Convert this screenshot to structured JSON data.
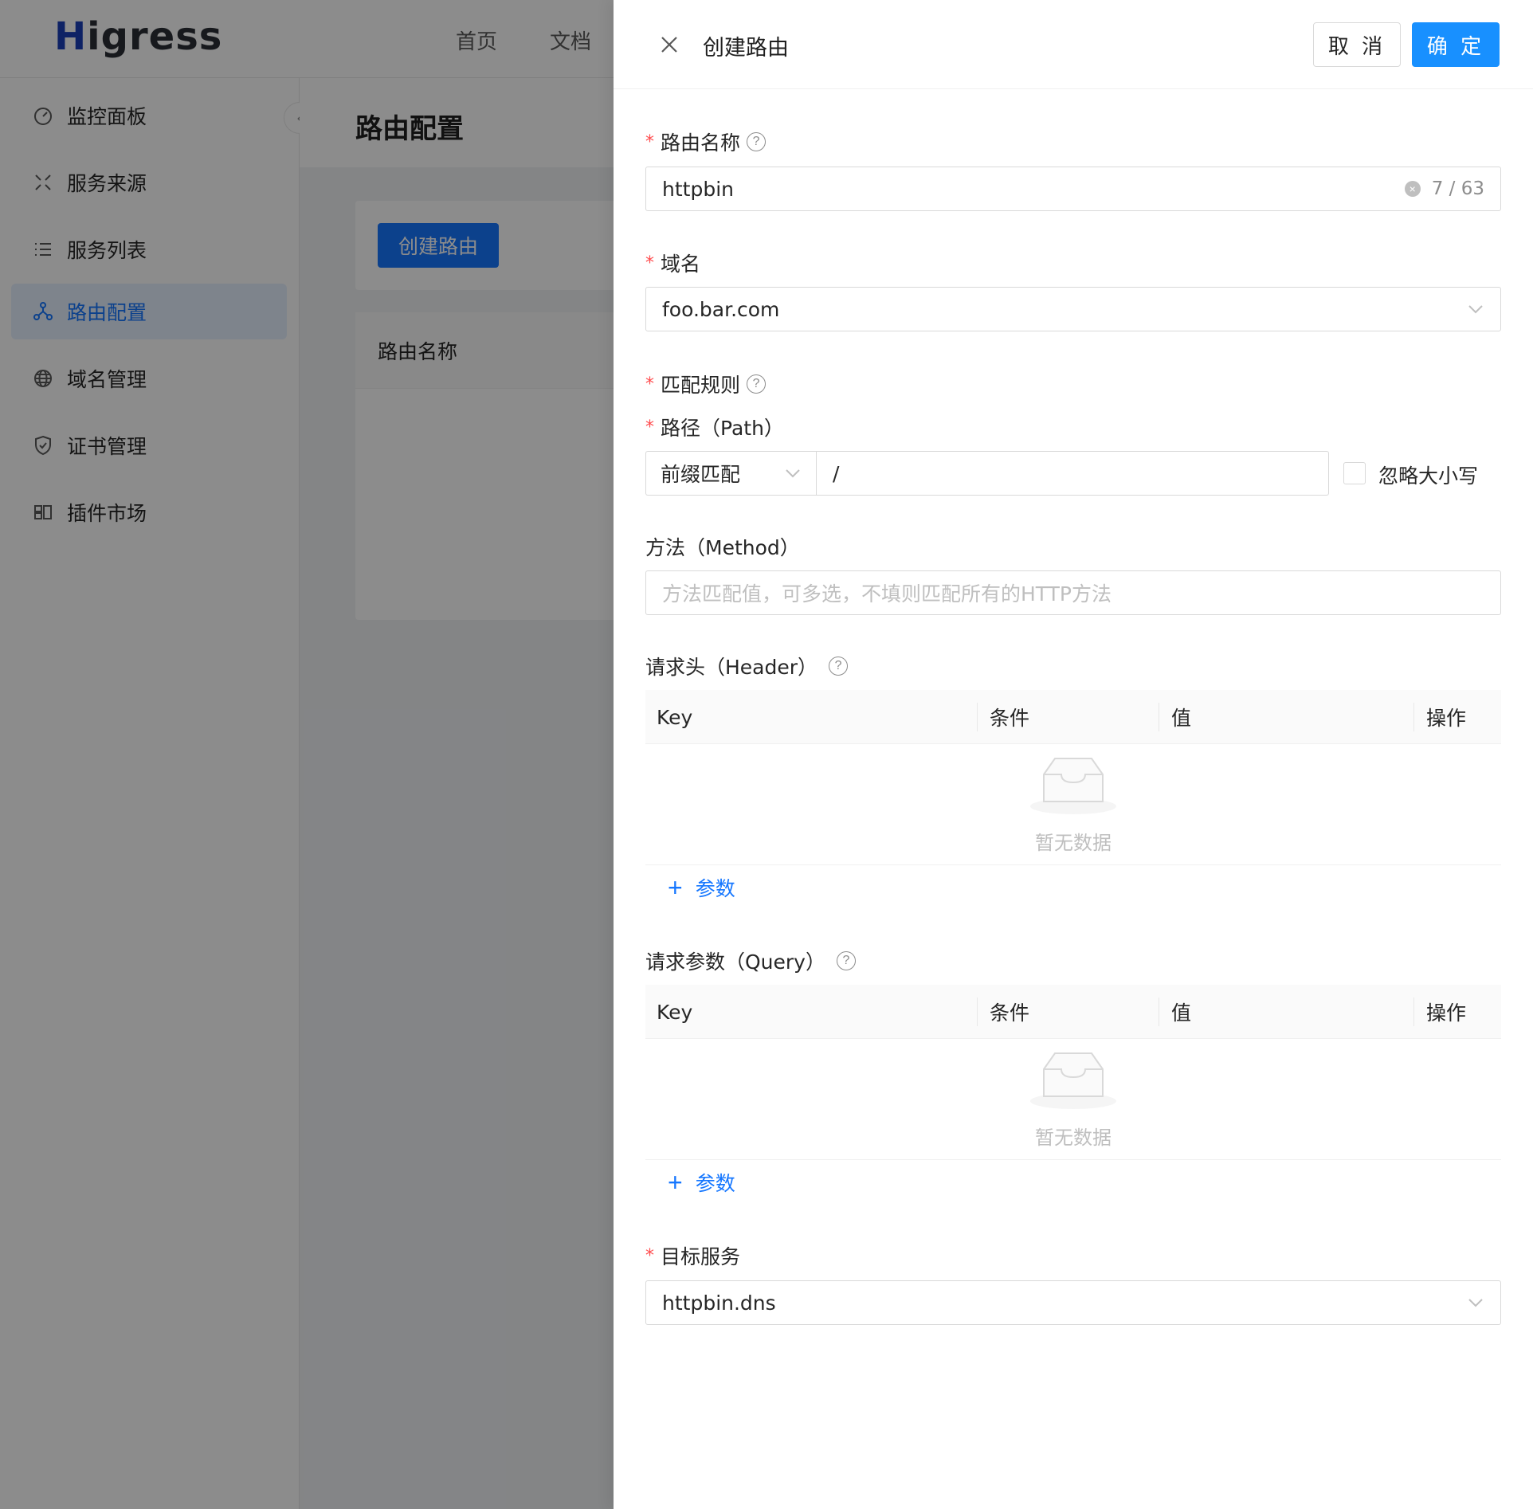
{
  "app": {
    "logo_prefix": "H",
    "logo_rest": "igress",
    "topnav": [
      "首页",
      "文档"
    ]
  },
  "sidebar": {
    "items": [
      {
        "label": "监控面板",
        "icon": "dashboard-icon"
      },
      {
        "label": "服务来源",
        "icon": "service-source-icon"
      },
      {
        "label": "服务列表",
        "icon": "list-icon"
      },
      {
        "label": "路由配置",
        "icon": "route-icon",
        "active": true
      },
      {
        "label": "域名管理",
        "icon": "globe-icon"
      },
      {
        "label": "证书管理",
        "icon": "shield-icon"
      },
      {
        "label": "插件市场",
        "icon": "plugin-icon"
      }
    ],
    "collapse_glyph": "‹"
  },
  "page": {
    "title": "路由配置",
    "create_button": "创建路由",
    "table_header": "路由名称"
  },
  "drawer": {
    "title": "创建路由",
    "cancel": "取 消",
    "ok": "确 定",
    "route_name": {
      "label": "路由名称",
      "value": "httpbin",
      "count": "7 / 63"
    },
    "domain": {
      "label": "域名",
      "value": "foo.bar.com"
    },
    "match_rule": {
      "label": "匹配规则"
    },
    "path": {
      "label": "路径（Path）",
      "match_type": "前缀匹配",
      "value": "/",
      "ignore_case": "忽略大小写"
    },
    "method": {
      "label": "方法（Method）",
      "placeholder": "方法匹配值，可多选，不填则匹配所有的HTTP方法"
    },
    "header": {
      "label": "请求头（Header）",
      "columns": [
        "Key",
        "条件",
        "值",
        "操作"
      ],
      "empty": "暂无数据",
      "add": "参数"
    },
    "query": {
      "label": "请求参数（Query）",
      "columns": [
        "Key",
        "条件",
        "值",
        "操作"
      ],
      "empty": "暂无数据",
      "add": "参数"
    },
    "target": {
      "label": "目标服务",
      "value": "httpbin.dns"
    }
  },
  "colors": {
    "primary": "#1677ff",
    "required": "#ff4d4f",
    "mask": "rgba(0,0,0,0.45)"
  }
}
